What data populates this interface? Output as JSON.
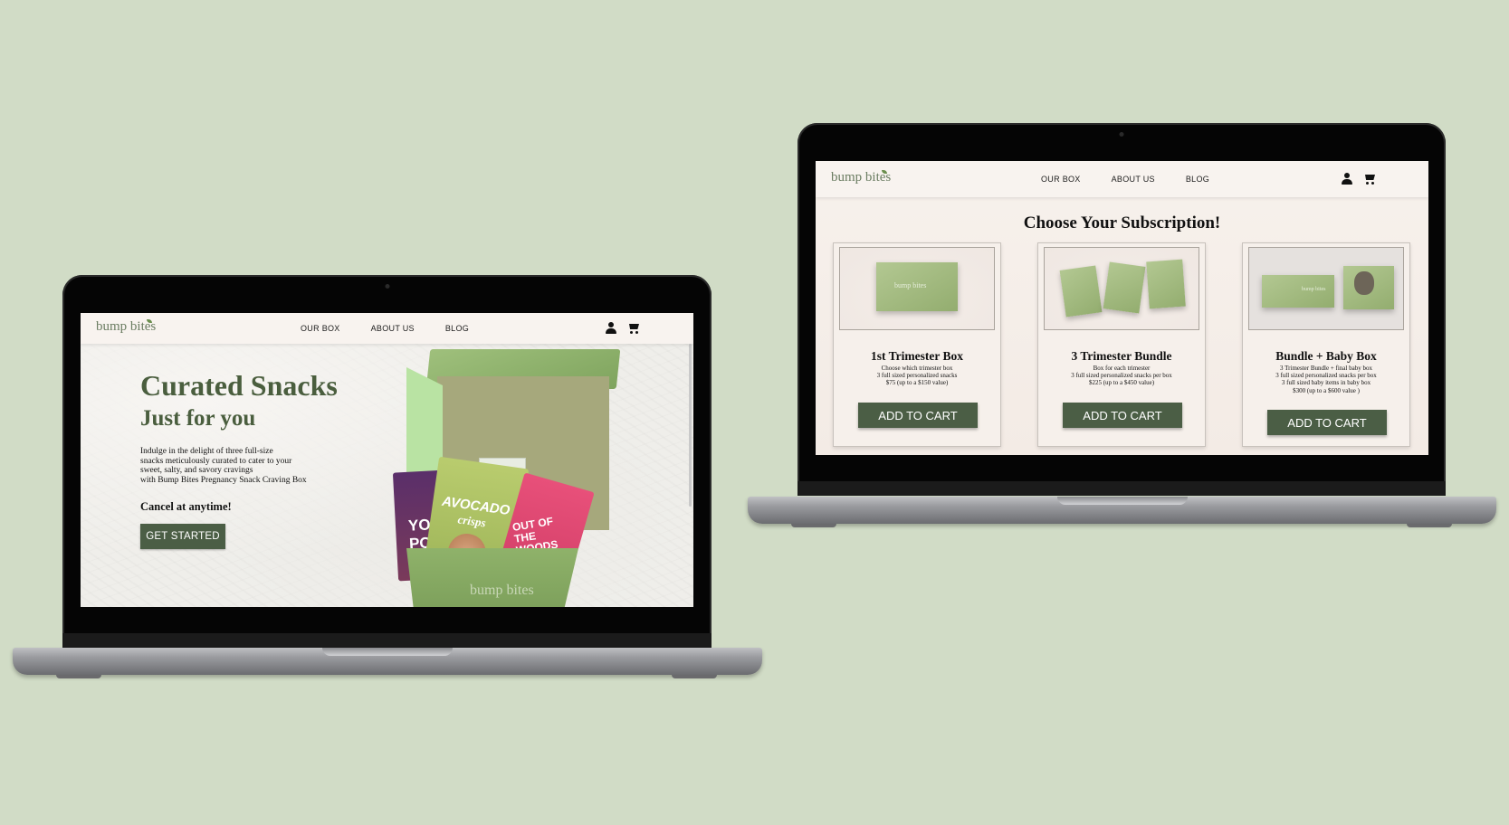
{
  "left_site": {
    "logo": "bump bites",
    "nav": [
      "OUR BOX",
      "ABOUT US",
      "BLOG"
    ],
    "hero": {
      "title": "Curated Snacks",
      "subtitle": "Just for you",
      "body": [
        "Indulge in the delight of three full-size",
        "snacks meticulously curated to cater to your",
        "sweet, salty, and savory cravings",
        "with Bump Bites Pregnancy Snack Craving Box"
      ],
      "cancel_text": "Cancel at anytime!",
      "cta_label": "GET STARTED"
    },
    "box_art": {
      "bag1_a": "YOG",
      "bag1_b": "POP",
      "bag2_a": "AVOCADO",
      "bag2_b": "crisps",
      "bag3": "OUT OF THE WOODS",
      "box_brand": "bump bites"
    }
  },
  "right_site": {
    "logo": "bump bites",
    "nav": [
      "OUR BOX",
      "ABOUT US",
      "BLOG"
    ],
    "heading": "Choose Your Subscription!",
    "products": [
      {
        "name": "1st Trimester Box",
        "lines": [
          "Choose which trimester box",
          "3 full sized personalized snacks",
          "$75 (up to a $150 value)"
        ],
        "button": "ADD TO CART"
      },
      {
        "name": "3 Trimester Bundle",
        "lines": [
          "Box for each trimester",
          "3 full sized personalized snacks per box",
          "$225 (up to a $450 value)"
        ],
        "button": "ADD TO CART"
      },
      {
        "name": "Bundle + Baby Box",
        "lines": [
          "3 Trimester Bundle + final baby box",
          "3 full sized personalized snacks per box",
          "3 full sized baby items in baby box",
          "$300 (up to a $600 value )"
        ],
        "button": "ADD TO CART"
      }
    ],
    "box_label": "bump bites"
  },
  "icons": [
    "user-icon",
    "cart-icon",
    "leaf-icon",
    "camera-icon"
  ],
  "colors": {
    "background": "#d1dcc6",
    "brand_green": "#4b5e45",
    "headline_green": "#4a5e3e",
    "box_green": "#8fb26a",
    "page_cream": "#f4eee8"
  }
}
